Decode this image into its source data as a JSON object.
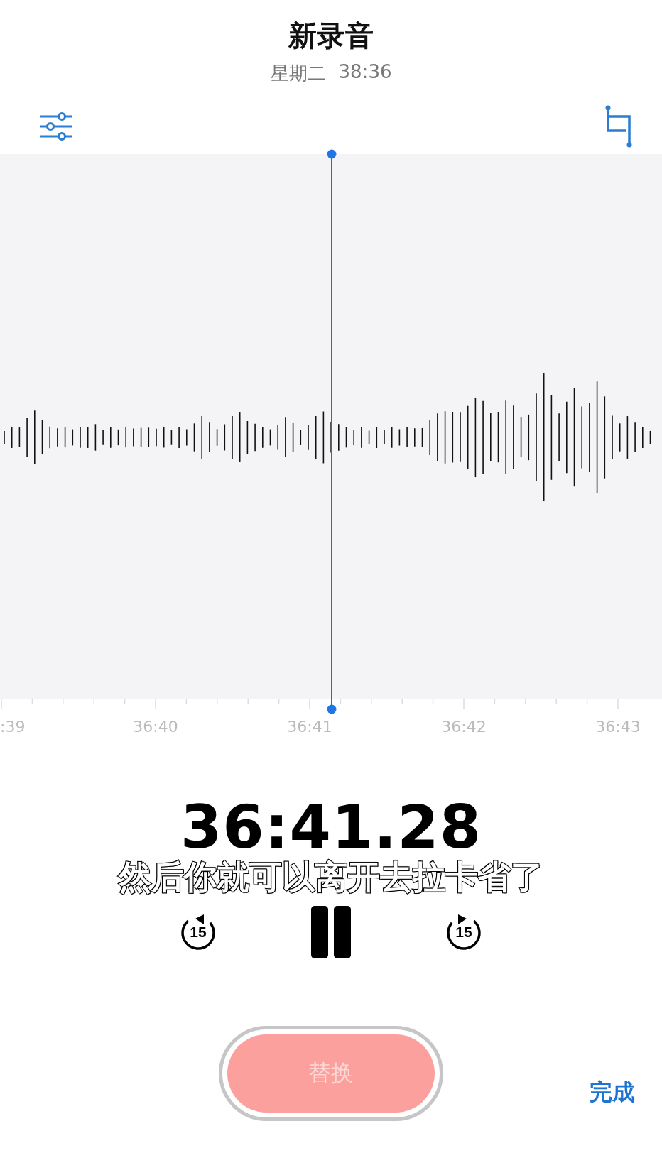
{
  "header": {
    "title": "新录音",
    "day": "星期二",
    "time": "38:36"
  },
  "timeline": {
    "labels": [
      ":39",
      "36:40",
      "36:41",
      "36:42",
      "36:43"
    ]
  },
  "elapsed": "36:41.28",
  "caption": "然后你就可以离开去拉卡省了",
  "controls": {
    "skip_back": "15",
    "skip_forward": "15"
  },
  "replace_button": {
    "label": "替换",
    "disabled": true
  },
  "done_button": "完成"
}
